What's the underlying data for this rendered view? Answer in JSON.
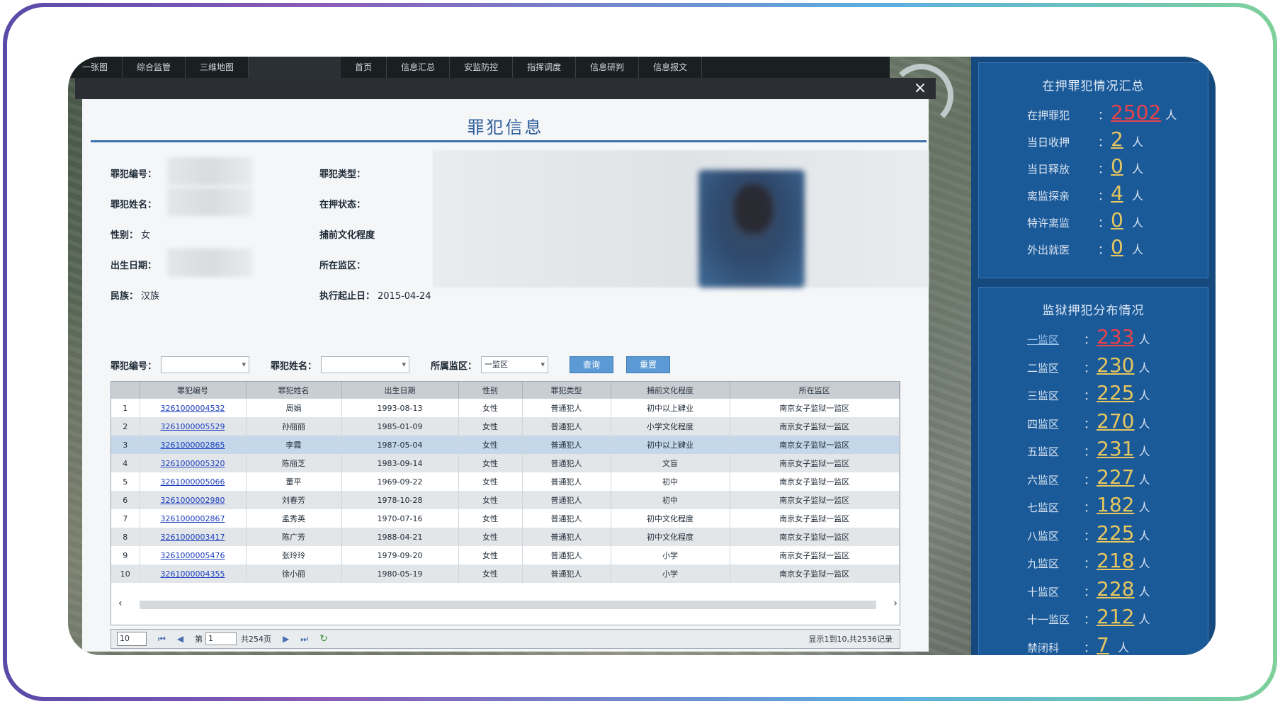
{
  "nav": {
    "items": [
      "一张图",
      "综合监管",
      "三维地图",
      "首页",
      "信息汇总",
      "安监防控",
      "指挥调度",
      "信息研判",
      "信息报文"
    ]
  },
  "modal": {
    "title": "罪犯信息",
    "close": "×",
    "fields": {
      "criminal_no_label": "罪犯编号：",
      "criminal_type_label": "罪犯类型：",
      "name_label": "罪犯姓名：",
      "custody_label": "在押状态：",
      "gender_label": "性别：",
      "gender_value": "女",
      "crime_label": "捕前文化程度",
      "birth_label": "出生日期：",
      "prison_label": "所在监区：",
      "ethnic_label": "民族：",
      "ethnic_value": "汉族",
      "start_date_label": "执行起止日：",
      "start_date_value": "2015-04-24"
    }
  },
  "search": {
    "criminal_no_label": "罪犯编号：",
    "name_label": "罪犯姓名：",
    "prison_label": "所属监区：",
    "prison_value": "一监区",
    "query_button": "查询",
    "reset_button": "重置"
  },
  "table": {
    "headers": [
      "",
      "罪犯编号",
      "罪犯姓名",
      "出生日期",
      "性别",
      "罪犯类型",
      "捕前文化程度",
      "所在监区"
    ],
    "rows": [
      [
        "1",
        "3261000004532",
        "周娟",
        "1993-08-13",
        "女性",
        "普通犯人",
        "初中以上肄业",
        "南京女子监狱一监区"
      ],
      [
        "2",
        "3261000005529",
        "孙丽丽",
        "1985-01-09",
        "女性",
        "普通犯人",
        "小学文化程度",
        "南京女子监狱一监区"
      ],
      [
        "3",
        "3261000002865",
        "李霞",
        "1987-05-04",
        "女性",
        "普通犯人",
        "初中以上肄业",
        "南京女子监狱一监区"
      ],
      [
        "4",
        "3261000005320",
        "陈丽芝",
        "1983-09-14",
        "女性",
        "普通犯人",
        "文盲",
        "南京女子监狱一监区"
      ],
      [
        "5",
        "3261000005066",
        "董平",
        "1969-09-22",
        "女性",
        "普通犯人",
        "初中",
        "南京女子监狱一监区"
      ],
      [
        "6",
        "3261000002980",
        "刘春芳",
        "1978-10-28",
        "女性",
        "普通犯人",
        "初中",
        "南京女子监狱一监区"
      ],
      [
        "7",
        "3261000002867",
        "孟秀英",
        "1970-07-16",
        "女性",
        "普通犯人",
        "初中文化程度",
        "南京女子监狱一监区"
      ],
      [
        "8",
        "3261000003417",
        "陈广芳",
        "1988-04-21",
        "女性",
        "普通犯人",
        "初中文化程度",
        "南京女子监狱一监区"
      ],
      [
        "9",
        "3261000005476",
        "张玲玲",
        "1979-09-20",
        "女性",
        "普通犯人",
        "小学",
        "南京女子监狱一监区"
      ],
      [
        "10",
        "3261000004355",
        "徐小丽",
        "1980-05-19",
        "女性",
        "普通犯人",
        "小学",
        "南京女子监狱一监区"
      ]
    ]
  },
  "pager": {
    "page_size": "10",
    "page_label": "第",
    "page_value": "1",
    "total_pages": "共254页",
    "summary": "显示1到10,共2536记录"
  },
  "right_panel": {
    "summary_title": "在押罪犯情况汇总",
    "summary": [
      {
        "label": "在押罪犯",
        "value": "2502",
        "unit": "人",
        "color": "red"
      },
      {
        "label": "当日收押",
        "value": "2",
        "unit": "人",
        "color": "gold"
      },
      {
        "label": "当日释放",
        "value": "0",
        "unit": "人",
        "color": "gold"
      },
      {
        "label": "离监探亲",
        "value": "4",
        "unit": "人",
        "color": "gold"
      },
      {
        "label": "特许离监",
        "value": "0",
        "unit": "人",
        "color": "gold"
      },
      {
        "label": "外出就医",
        "value": "0",
        "unit": "人",
        "color": "gold"
      }
    ],
    "distribution_title": "监狱押犯分布情况",
    "distribution": [
      {
        "label": "一监区",
        "value": "233",
        "unit": "人",
        "color": "red",
        "link": true
      },
      {
        "label": "二监区",
        "value": "230",
        "unit": "人",
        "color": "gold"
      },
      {
        "label": "三监区",
        "value": "225",
        "unit": "人",
        "color": "gold"
      },
      {
        "label": "四监区",
        "value": "270",
        "unit": "人",
        "color": "gold"
      },
      {
        "label": "五监区",
        "value": "231",
        "unit": "人",
        "color": "gold"
      },
      {
        "label": "六监区",
        "value": "227",
        "unit": "人",
        "color": "gold"
      },
      {
        "label": "七监区",
        "value": "182",
        "unit": "人",
        "color": "gold"
      },
      {
        "label": "八监区",
        "value": "225",
        "unit": "人",
        "color": "gold"
      },
      {
        "label": "九监区",
        "value": "218",
        "unit": "人",
        "color": "gold"
      },
      {
        "label": "十监区",
        "value": "228",
        "unit": "人",
        "color": "gold"
      },
      {
        "label": "十一监区",
        "value": "212",
        "unit": "人",
        "color": "gold"
      },
      {
        "label": "禁闭科",
        "value": "7",
        "unit": "人",
        "color": "gold"
      }
    ]
  },
  "colors": {
    "panel_bg": "#16497e",
    "accent_red": "#e8424a",
    "accent_gold": "#e6c65e",
    "link_blue": "#1c3fbf",
    "title_blue": "#2f5d9a"
  }
}
